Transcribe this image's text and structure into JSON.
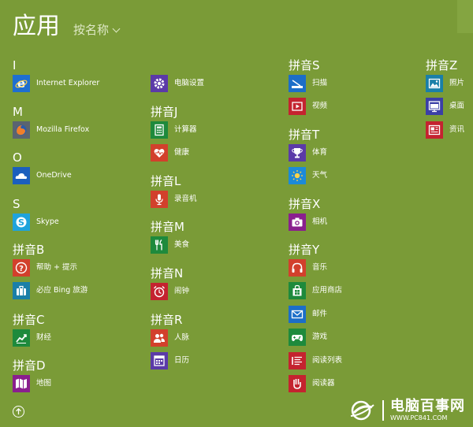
{
  "header": {
    "title": "应用",
    "sort_label": "按名称"
  },
  "groups": [
    {
      "label": "I",
      "apps": [
        {
          "label": "Internet Explorer",
          "icon": "ie-icon",
          "color": "#1e6fd0"
        }
      ]
    },
    {
      "label": "M",
      "apps": [
        {
          "label": "Mozilla Firefox",
          "icon": "firefox-icon",
          "color": "#5a6470"
        }
      ]
    },
    {
      "label": "O",
      "apps": [
        {
          "label": "OneDrive",
          "icon": "onedrive-icon",
          "color": "#1b5fbd"
        }
      ]
    },
    {
      "label": "S",
      "apps": [
        {
          "label": "Skype",
          "icon": "skype-icon",
          "color": "#1fa3dc"
        }
      ]
    },
    {
      "label": "拼音B",
      "apps": [
        {
          "label": "帮助 + 提示",
          "icon": "help-icon",
          "color": "#d2402c"
        },
        {
          "label": "必应 Bing 旅游",
          "icon": "suitcase-icon",
          "color": "#1a7fa8"
        }
      ]
    },
    {
      "label": "拼音C",
      "apps": [
        {
          "label": "财经",
          "icon": "finance-icon",
          "color": "#1e8a3c"
        }
      ]
    },
    {
      "label": "拼音D",
      "apps": [
        {
          "label": "地图",
          "icon": "map-icon",
          "color": "#8a1f8e"
        }
      ]
    },
    {
      "label": "",
      "apps": [
        {
          "label": "电脑设置",
          "icon": "gear-icon",
          "color": "#5b3aa8"
        }
      ]
    },
    {
      "label": "拼音J",
      "apps": [
        {
          "label": "计算器",
          "icon": "calculator-icon",
          "color": "#1e8a3c"
        },
        {
          "label": "健康",
          "icon": "health-icon",
          "color": "#d2402c"
        }
      ]
    },
    {
      "label": "拼音L",
      "apps": [
        {
          "label": "录音机",
          "icon": "microphone-icon",
          "color": "#d2402c"
        }
      ]
    },
    {
      "label": "拼音M",
      "apps": [
        {
          "label": "美食",
          "icon": "food-icon",
          "color": "#1e8a3c"
        }
      ]
    },
    {
      "label": "拼音N",
      "apps": [
        {
          "label": "闹钟",
          "icon": "alarm-icon",
          "color": "#c4232f"
        }
      ]
    },
    {
      "label": "拼音R",
      "apps": [
        {
          "label": "人脉",
          "icon": "people-icon",
          "color": "#d2402c"
        },
        {
          "label": "日历",
          "icon": "calendar-icon",
          "color": "#5b3aa8"
        }
      ]
    },
    {
      "label": "拼音S",
      "apps": [
        {
          "label": "扫描",
          "icon": "scanner-icon",
          "color": "#1c6ec8"
        },
        {
          "label": "视频",
          "icon": "video-icon",
          "color": "#c4232f"
        }
      ]
    },
    {
      "label": "拼音T",
      "apps": [
        {
          "label": "体育",
          "icon": "trophy-icon",
          "color": "#5b3aa8"
        },
        {
          "label": "天气",
          "icon": "sun-icon",
          "color": "#1c8ad8"
        }
      ]
    },
    {
      "label": "拼音X",
      "apps": [
        {
          "label": "相机",
          "icon": "camera-icon",
          "color": "#8a1f8e"
        }
      ]
    },
    {
      "label": "拼音Y",
      "apps": [
        {
          "label": "音乐",
          "icon": "headphones-icon",
          "color": "#d2402c"
        },
        {
          "label": "应用商店",
          "icon": "store-icon",
          "color": "#1e8a3c"
        },
        {
          "label": "邮件",
          "icon": "mail-icon",
          "color": "#1c6ec8"
        },
        {
          "label": "游戏",
          "icon": "gamepad-icon",
          "color": "#1e8a3c"
        },
        {
          "label": "阅读列表",
          "icon": "reading-list-icon",
          "color": "#c4232f"
        },
        {
          "label": "阅读器",
          "icon": "reader-icon",
          "color": "#c4232f"
        }
      ]
    },
    {
      "label": "拼音Z",
      "apps": [
        {
          "label": "照片",
          "icon": "photos-icon",
          "color": "#1a7fa8"
        },
        {
          "label": "桌面",
          "icon": "desktop-icon",
          "color": "#3b3fa6"
        },
        {
          "label": "资讯",
          "icon": "news-icon",
          "color": "#c4232f"
        }
      ]
    }
  ],
  "watermark": {
    "name": "电脑百事网",
    "url": "WWW.PC841.COM"
  },
  "colors": {
    "background": "#7a9b37"
  }
}
